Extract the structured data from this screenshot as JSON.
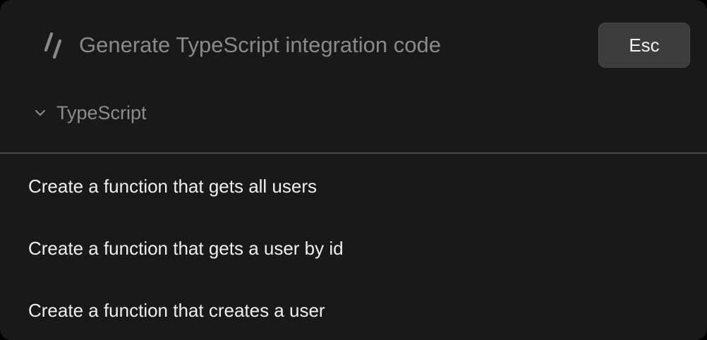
{
  "header": {
    "logo_icon": "slash-logo-icon",
    "title": "Generate TypeScript integration code",
    "esc_label": "Esc"
  },
  "language": {
    "chevron_icon": "chevron-down-icon",
    "label": "TypeScript"
  },
  "suggestions": [
    {
      "label": "Create a function that gets all users"
    },
    {
      "label": "Create a function that gets a user by id"
    },
    {
      "label": "Create a function that creates a user"
    }
  ],
  "colors": {
    "panel_background": "#191919",
    "title_text": "#8a8a8a",
    "item_text": "#efefef",
    "button_background": "#3d3d3d",
    "divider": "#4a4a4a"
  }
}
